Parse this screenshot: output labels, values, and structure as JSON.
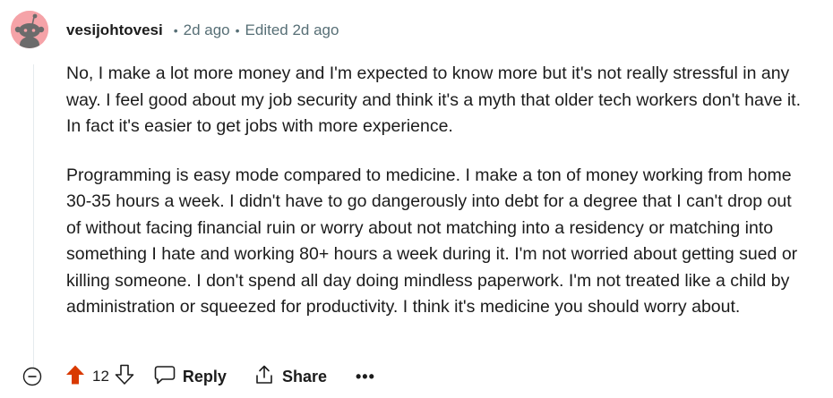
{
  "comment": {
    "author": "vesijohtovesi",
    "age": "2d ago",
    "edited": "Edited 2d ago",
    "paragraphs": [
      "No, I make a lot more money and I'm expected to know more but it's not really stressful in any way. I feel good about my job security and think it's a myth that older tech workers don't have it. In fact it's easier to get jobs with more experience.",
      "Programming is easy mode compared to medicine. I make a ton of money working from home 30-35 hours a week. I didn't have to go dangerously into debt for a degree that I can't drop out of without facing financial ruin or worry about not matching into a residency or matching into something I hate and working 80+ hours a week during it. I'm not worried about getting sued or killing someone. I don't spend all day doing mindless paperwork. I'm not treated like a child by administration or squeezed for productivity. I think it's medicine you should worry about."
    ],
    "score": "12",
    "reply_label": "Reply",
    "share_label": "Share",
    "more_label": "•••"
  },
  "colors": {
    "avatar_bg": "#f5a3a8",
    "upvote_active": "#d93900",
    "meta_text": "#576f76",
    "thread_line": "#e5ebee"
  },
  "icons": {
    "avatar": "snoo-avatar-icon",
    "collapse": "collapse-minus-icon",
    "upvote": "upvote-arrow-icon",
    "downvote": "downvote-arrow-icon",
    "reply": "speech-bubble-icon",
    "share": "share-upload-icon",
    "more": "more-options-icon"
  }
}
